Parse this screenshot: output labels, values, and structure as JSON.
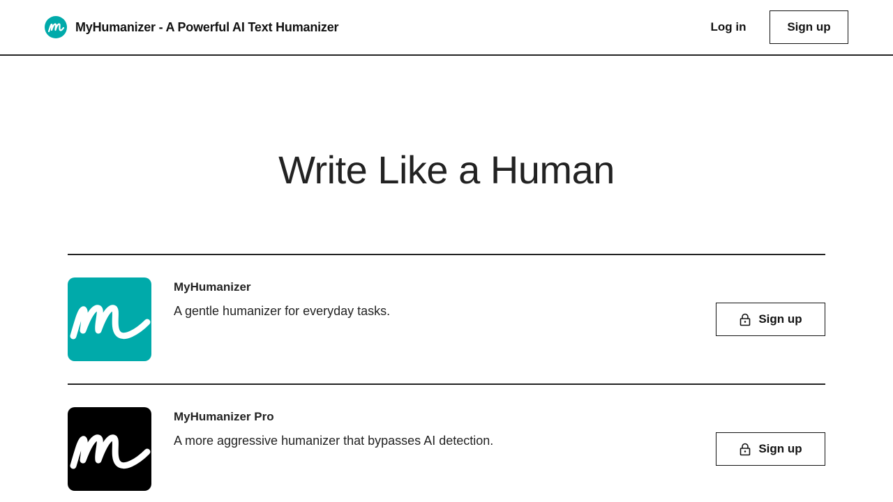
{
  "header": {
    "brand_title": "MyHumanizer - A Powerful AI Text Humanizer",
    "login_label": "Log in",
    "signup_label": "Sign up"
  },
  "hero": {
    "title": "Write Like a Human"
  },
  "products": [
    {
      "name": "MyHumanizer",
      "description": "A gentle humanizer for everyday tasks.",
      "button_label": "Sign up",
      "icon": "m-logo-icon",
      "icon_bg": "#00AAAA"
    },
    {
      "name": "MyHumanizer Pro",
      "description": "A more aggressive humanizer that bypasses AI detection.",
      "button_label": "Sign up",
      "icon": "m-logo-icon",
      "icon_bg": "#000000"
    }
  ],
  "colors": {
    "accent": "#00AAAA",
    "text": "#222222",
    "border": "#111111"
  }
}
